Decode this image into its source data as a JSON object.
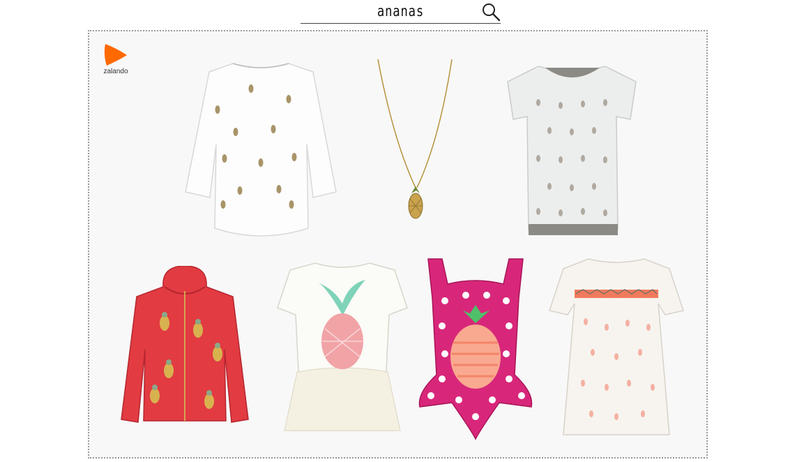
{
  "search": {
    "query": "ananas"
  },
  "brand": {
    "name": "zalando",
    "color": "#ff6900"
  },
  "products": [
    {
      "name": "white-three-quarter-top-pineapple-embellished"
    },
    {
      "name": "gold-pineapple-pendant-necklace"
    },
    {
      "name": "grey-pineapple-print-tshirt"
    },
    {
      "name": "red-hoodie-sequin-pineapples"
    },
    {
      "name": "white-tutu-top-pineapple-print"
    },
    {
      "name": "pink-polka-dot-swimsuit-ruffle-pineapple"
    },
    {
      "name": "white-dress-pineapple-print"
    }
  ]
}
